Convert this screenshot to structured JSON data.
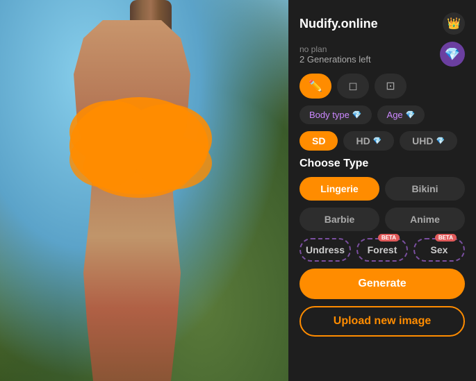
{
  "app": {
    "title": "Nudify.online",
    "crown_icon": "👑",
    "gem_icon": "💎"
  },
  "plan": {
    "no_plan_label": "no plan",
    "generations_label": "2 Generations left"
  },
  "tools": [
    {
      "id": "brush",
      "icon": "✏️",
      "active": true
    },
    {
      "id": "eraser",
      "icon": "⬜",
      "active": false
    },
    {
      "id": "crop",
      "icon": "⊡",
      "active": false
    }
  ],
  "options": [
    {
      "id": "body-type",
      "label": "Body type",
      "has_diamond": true
    },
    {
      "id": "age",
      "label": "Age",
      "has_diamond": true
    }
  ],
  "quality": {
    "options": [
      {
        "id": "sd",
        "label": "SD",
        "active": true,
        "has_diamond": false
      },
      {
        "id": "hd",
        "label": "HD",
        "active": false,
        "has_diamond": true
      },
      {
        "id": "uhd",
        "label": "UHD",
        "active": false,
        "has_diamond": true
      }
    ]
  },
  "choose_type": {
    "label": "Choose Type",
    "types_row1": [
      {
        "id": "lingerie",
        "label": "Lingerie",
        "active": true,
        "dashed": false
      },
      {
        "id": "bikini",
        "label": "Bikini",
        "active": false,
        "dashed": false
      }
    ],
    "types_row2": [
      {
        "id": "barbie",
        "label": "Barbie",
        "active": false,
        "dashed": false
      },
      {
        "id": "anime",
        "label": "Anime",
        "active": false,
        "dashed": false
      }
    ],
    "types_row3": [
      {
        "id": "undress",
        "label": "Undress",
        "active": false,
        "dashed": true,
        "beta": false
      },
      {
        "id": "forest",
        "label": "Forest",
        "active": false,
        "dashed": true,
        "beta": true
      },
      {
        "id": "sex",
        "label": "Sex",
        "active": false,
        "dashed": true,
        "beta": true
      }
    ]
  },
  "buttons": {
    "generate": "Generate",
    "upload": "Upload new image"
  }
}
